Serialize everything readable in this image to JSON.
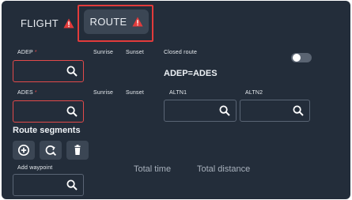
{
  "tabs": {
    "flight": "FLIGHT",
    "route": "ROUTE"
  },
  "labels": {
    "adep": "ADEP",
    "ades": "ADES",
    "sunrise": "Sunrise",
    "sunset": "Sunset",
    "closed_route": "Closed route",
    "altn1": "ALTN1",
    "altn2": "ALTN2",
    "add_waypoint": "Add waypoint",
    "required_mark": "*"
  },
  "fields": {
    "adep_value": "",
    "ades_value": "",
    "altn1_value": "",
    "altn2_value": "",
    "waypoint_value": ""
  },
  "closed_route_text": "ADEP=ADES",
  "closed_route_enabled": false,
  "route_segments": {
    "title": "Route segments",
    "buttons": [
      "add-segment",
      "search-replace",
      "delete"
    ]
  },
  "totals": {
    "time_label": "Total time",
    "distance_label": "Total distance"
  },
  "colors": {
    "background": "#232d3a",
    "error": "#e24a4a",
    "tab_active": "#3b4654"
  }
}
